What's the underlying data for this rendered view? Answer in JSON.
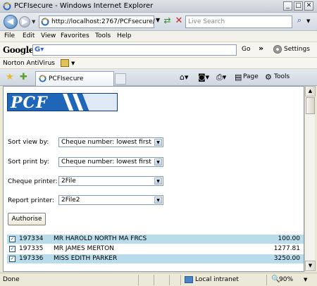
{
  "window": {
    "title": "PCFIsecure - Windows Internet Explorer"
  },
  "address": {
    "url": "http://localhost:2767/PCFsecure/",
    "search_placeholder": "Live Search"
  },
  "menu": {
    "items": [
      "File",
      "Edit",
      "View",
      "Favorites",
      "Tools",
      "Help"
    ]
  },
  "google_toolbar": {
    "logo": "Google",
    "go_label": "Go",
    "settings_label": "Settings"
  },
  "norton_toolbar": {
    "label": "Norton AntiVirus"
  },
  "tabs": {
    "active_label": "PCFIsecure"
  },
  "command_bar": {
    "page_label": "Page",
    "tools_label": "Tools"
  },
  "logo": {
    "text": "PCF",
    "color": "#1f66b8"
  },
  "form": {
    "sort_view": {
      "label": "Sort view by:",
      "value": "Cheque number: lowest first"
    },
    "sort_print": {
      "label": "Sort print by:",
      "value": "Cheque number: lowest first"
    },
    "cheque_printer": {
      "label": "Cheque printer:",
      "value": "2File"
    },
    "report_printer": {
      "label": "Report printer:",
      "value": "2File2"
    },
    "authorise_label": "Authorise"
  },
  "cheques": [
    {
      "number": "197334",
      "payee": "MR HAROLD NORTH MA FRCS",
      "amount": "100.00",
      "checked": true
    },
    {
      "number": "197335",
      "payee": "MR JAMES MERTON",
      "amount": "1277.81",
      "checked": true
    },
    {
      "number": "197336",
      "payee": "MISS EDITH PARKER",
      "amount": "3250.00",
      "checked": true
    }
  ],
  "status": {
    "text": "Done",
    "zone": "Local intranet",
    "zoom": "90%"
  },
  "colors": {
    "row_highlight": "#b8dce9",
    "checkbox": "#1c5180"
  }
}
